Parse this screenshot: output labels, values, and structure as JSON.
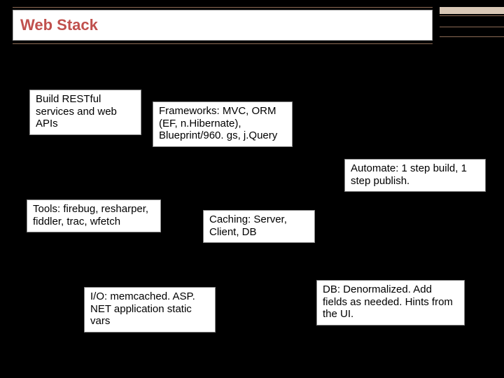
{
  "title": "Web Stack",
  "boxes": {
    "restful": "Build RESTful services and web APIs",
    "frameworks": "Frameworks: MVC, ORM (EF, n.Hibernate), Blueprint/960. gs, j.Query",
    "automate": "Automate: 1 step build, 1 step publish.",
    "tools": "Tools: firebug, resharper, fiddler, trac, wfetch",
    "caching": "Caching: Server, Client, DB",
    "io": "I/O: memcached. ASP. NET application static vars",
    "db": "DB: Denormalized. Add fields as needed. Hints from the UI."
  }
}
